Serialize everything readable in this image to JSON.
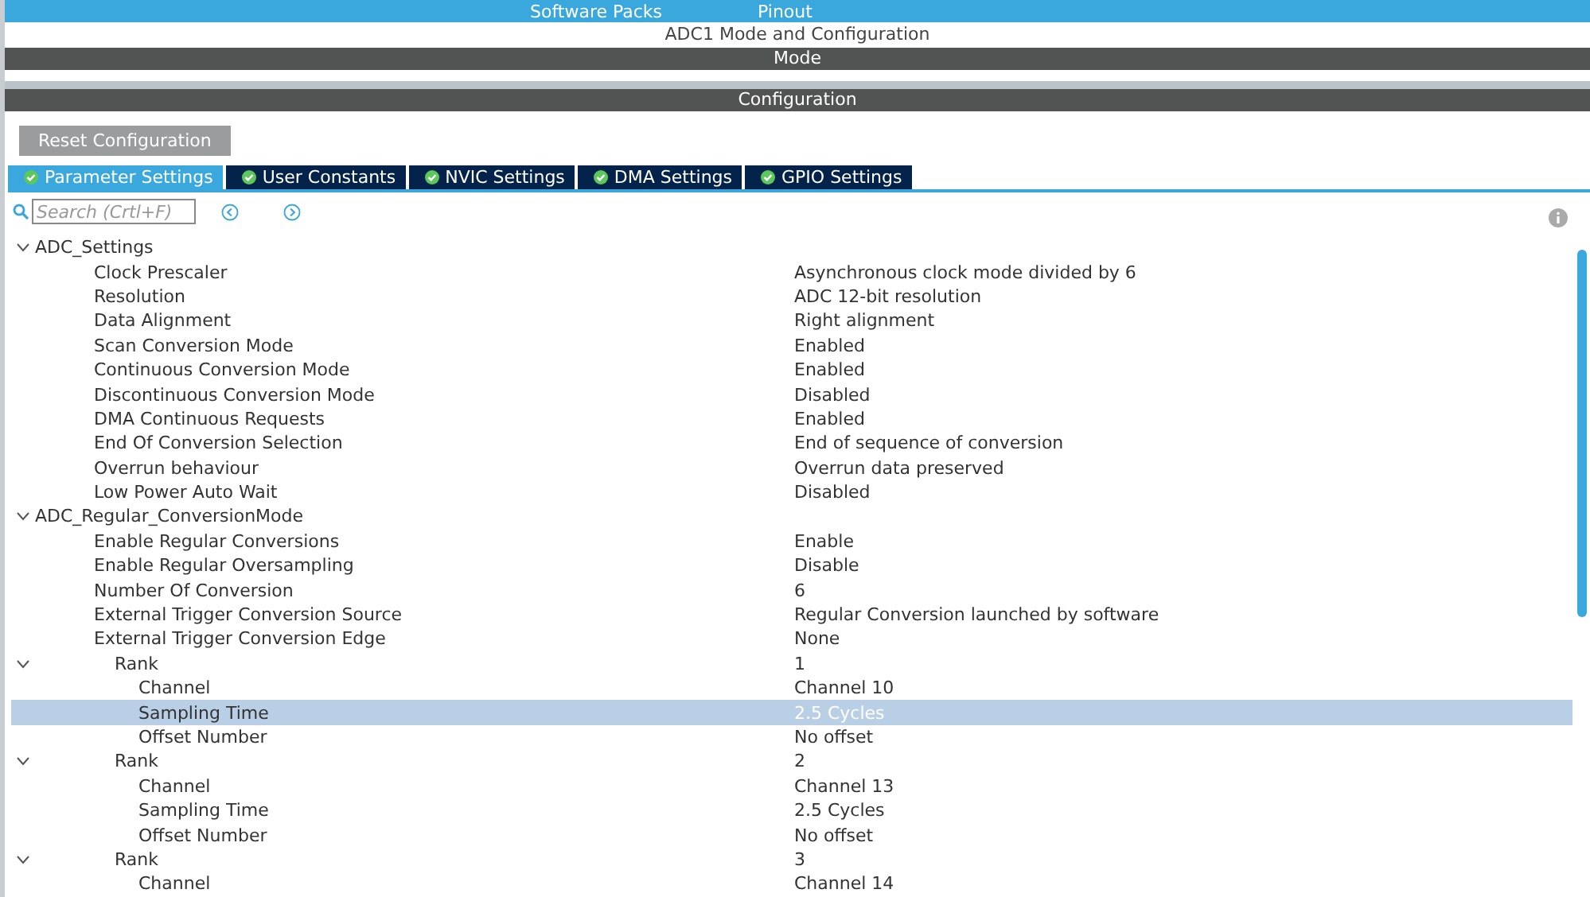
{
  "top_menu": [
    {
      "label": "Software Packs"
    },
    {
      "label": "Pinout"
    }
  ],
  "title": "ADC1 Mode and Configuration",
  "mode_header": "Mode",
  "config_header": "Configuration",
  "reset_button": "Reset Configuration",
  "tabs": [
    {
      "label": "Parameter Settings",
      "selected": true
    },
    {
      "label": "User Constants",
      "selected": false
    },
    {
      "label": "NVIC Settings",
      "selected": false
    },
    {
      "label": "DMA Settings",
      "selected": false
    },
    {
      "label": "GPIO Settings",
      "selected": false
    }
  ],
  "search": {
    "placeholder": "Search (Crtl+F)"
  },
  "tree": [
    {
      "label": "ADC_Settings",
      "expanded": true,
      "selected": false,
      "children": [
        {
          "label": "Clock Prescaler",
          "value": "Asynchronous clock mode divided by 6",
          "selected": false
        },
        {
          "label": "Resolution",
          "value": "ADC 12-bit resolution",
          "selected": false
        },
        {
          "label": "Data Alignment",
          "value": "Right alignment",
          "selected": false
        },
        {
          "label": "Scan Conversion Mode",
          "value": "Enabled",
          "selected": false
        },
        {
          "label": "Continuous Conversion Mode",
          "value": "Enabled",
          "selected": false
        },
        {
          "label": "Discontinuous Conversion Mode",
          "value": "Disabled",
          "selected": false
        },
        {
          "label": "DMA Continuous Requests",
          "value": "Enabled",
          "selected": false
        },
        {
          "label": "End Of Conversion Selection",
          "value": "End of sequence of conversion",
          "selected": false
        },
        {
          "label": "Overrun behaviour",
          "value": "Overrun data preserved",
          "selected": false
        },
        {
          "label": "Low Power Auto Wait",
          "value": "Disabled",
          "selected": false
        }
      ]
    },
    {
      "label": "ADC_Regular_ConversionMode",
      "expanded": true,
      "selected": false,
      "children": [
        {
          "label": "Enable Regular Conversions",
          "value": "Enable",
          "selected": false
        },
        {
          "label": "Enable Regular Oversampling",
          "value": "Disable",
          "selected": false
        },
        {
          "label": "Number Of Conversion",
          "value": "6",
          "selected": false
        },
        {
          "label": "External Trigger Conversion Source",
          "value": "Regular Conversion launched by software",
          "selected": false
        },
        {
          "label": "External Trigger Conversion Edge",
          "value": "None",
          "selected": false
        },
        {
          "label": "Rank",
          "value": "1",
          "expanded": true,
          "selected": false,
          "children": [
            {
              "label": "Channel",
              "value": "Channel 10",
              "selected": false
            },
            {
              "label": "Sampling Time",
              "value": "2.5 Cycles",
              "selected": true
            },
            {
              "label": "Offset Number",
              "value": "No offset",
              "selected": false
            }
          ]
        },
        {
          "label": "Rank",
          "value": "2",
          "expanded": true,
          "selected": false,
          "children": [
            {
              "label": "Channel",
              "value": "Channel 13",
              "selected": false
            },
            {
              "label": "Sampling Time",
              "value": "2.5 Cycles",
              "selected": false
            },
            {
              "label": "Offset Number",
              "value": "No offset",
              "selected": false
            }
          ]
        },
        {
          "label": "Rank",
          "value": "3",
          "expanded": true,
          "selected": false,
          "children": [
            {
              "label": "Channel",
              "value": "Channel 14",
              "selected": false
            }
          ]
        }
      ]
    }
  ]
}
